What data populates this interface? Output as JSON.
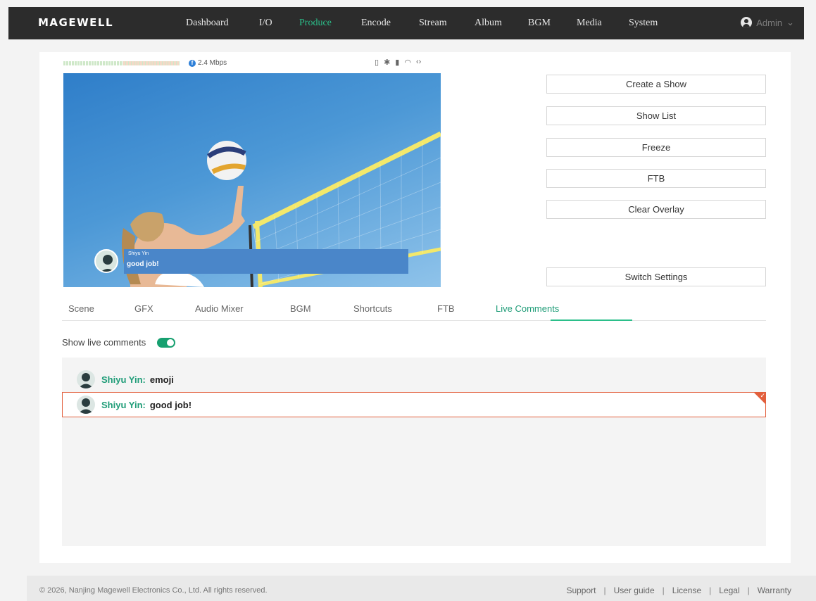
{
  "app": {
    "logo": "MAGEWELL"
  },
  "nav": {
    "items": [
      {
        "label": "Dashboard"
      },
      {
        "label": "I/O"
      },
      {
        "label": "Produce"
      },
      {
        "label": "Encode"
      },
      {
        "label": "Stream"
      },
      {
        "label": "Album"
      },
      {
        "label": "BGM"
      },
      {
        "label": "Media"
      },
      {
        "label": "System"
      }
    ],
    "active": "Produce",
    "user": "Admin",
    "user_chevron": "⌄"
  },
  "status": {
    "bitrate": "2.4 Mbps",
    "icons": [
      "sd-card-icon",
      "bluetooth-icon",
      "battery-icon",
      "wifi-icon",
      "code-icon"
    ]
  },
  "preview": {
    "overlay_name": "Shiyu Yin",
    "overlay_text": "good job!"
  },
  "actions": {
    "create_show": "Create a Show",
    "show_list": "Show List",
    "freeze": "Freeze",
    "ftb": "FTB",
    "clear_overlay": "Clear Overlay",
    "switch_settings": "Switch Settings"
  },
  "tabs": [
    {
      "label": "Scene"
    },
    {
      "label": "GFX"
    },
    {
      "label": "Audio Mixer"
    },
    {
      "label": "BGM"
    },
    {
      "label": "Shortcuts"
    },
    {
      "label": "FTB"
    },
    {
      "label": "Live Comments"
    }
  ],
  "active_tab": "Live Comments",
  "live_comments": {
    "toggle_label": "Show live comments",
    "enabled": true,
    "comments": [
      {
        "name": "Shiyu Yin:",
        "text": "emoji",
        "selected": false
      },
      {
        "name": "Shiyu Yin:",
        "text": "good job!",
        "selected": true
      }
    ]
  },
  "footer": {
    "copyright": "© 2026, Nanjing Magewell Electronics Co., Ltd. All rights reserved.",
    "links": [
      "Support",
      "User guide",
      "License",
      "Legal",
      "Warranty"
    ]
  },
  "colors": {
    "accent": "#2bbf8a",
    "selected_border": "#e25f3c",
    "nav_bg": "#2c2c2c"
  }
}
